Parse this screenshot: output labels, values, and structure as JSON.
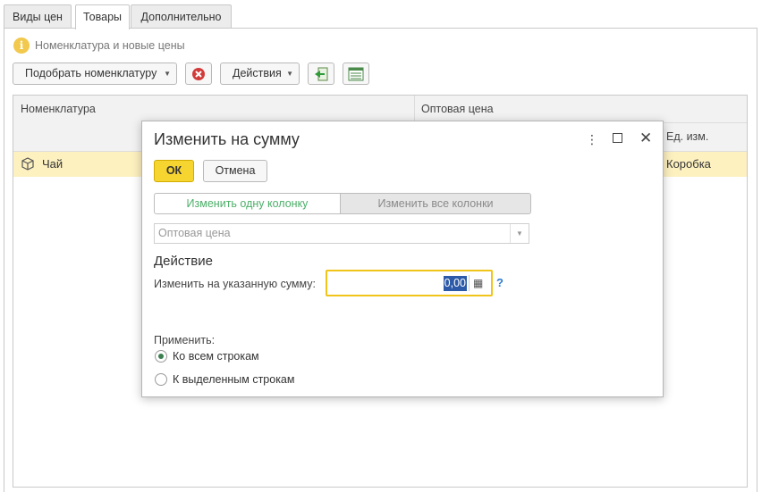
{
  "tabs": [
    {
      "label": "Виды цен"
    },
    {
      "label": "Товары"
    },
    {
      "label": "Дополнительно"
    }
  ],
  "info": {
    "icon": "info-icon",
    "text": "Номенклатура и новые цены"
  },
  "toolbar": {
    "pick_label": "Подобрать номенклатуру",
    "delete_icon": "delete-icon",
    "actions_label": "Действия",
    "import_icon": "import-icon",
    "settings_icon": "table-settings-icon"
  },
  "table": {
    "columns": {
      "item": "Номенклатура",
      "wholesale": "Оптовая цена",
      "unit": "Ед. изм."
    },
    "rows": [
      {
        "icon": "product-icon",
        "name": "Чай",
        "unit": "Коробка"
      }
    ]
  },
  "modal": {
    "title": "Изменить на сумму",
    "ok_label": "ОК",
    "cancel_label": "Отмена",
    "seg_one": "Изменить одну колонку",
    "seg_all": "Изменить все колонки",
    "column_select": "Оптовая цена",
    "section_title": "Действие",
    "amount_label": "Изменить на указанную сумму:",
    "amount_value": "0,00",
    "help": "?",
    "apply_label": "Применить:",
    "apply_options": [
      {
        "label": "Ко всем строкам",
        "selected": true
      },
      {
        "label": "К выделенным строкам",
        "selected": false
      }
    ]
  },
  "colors": {
    "accent_yellow": "#f7d531",
    "selected_row": "#fdf1c0",
    "green_text": "#4caf68"
  }
}
